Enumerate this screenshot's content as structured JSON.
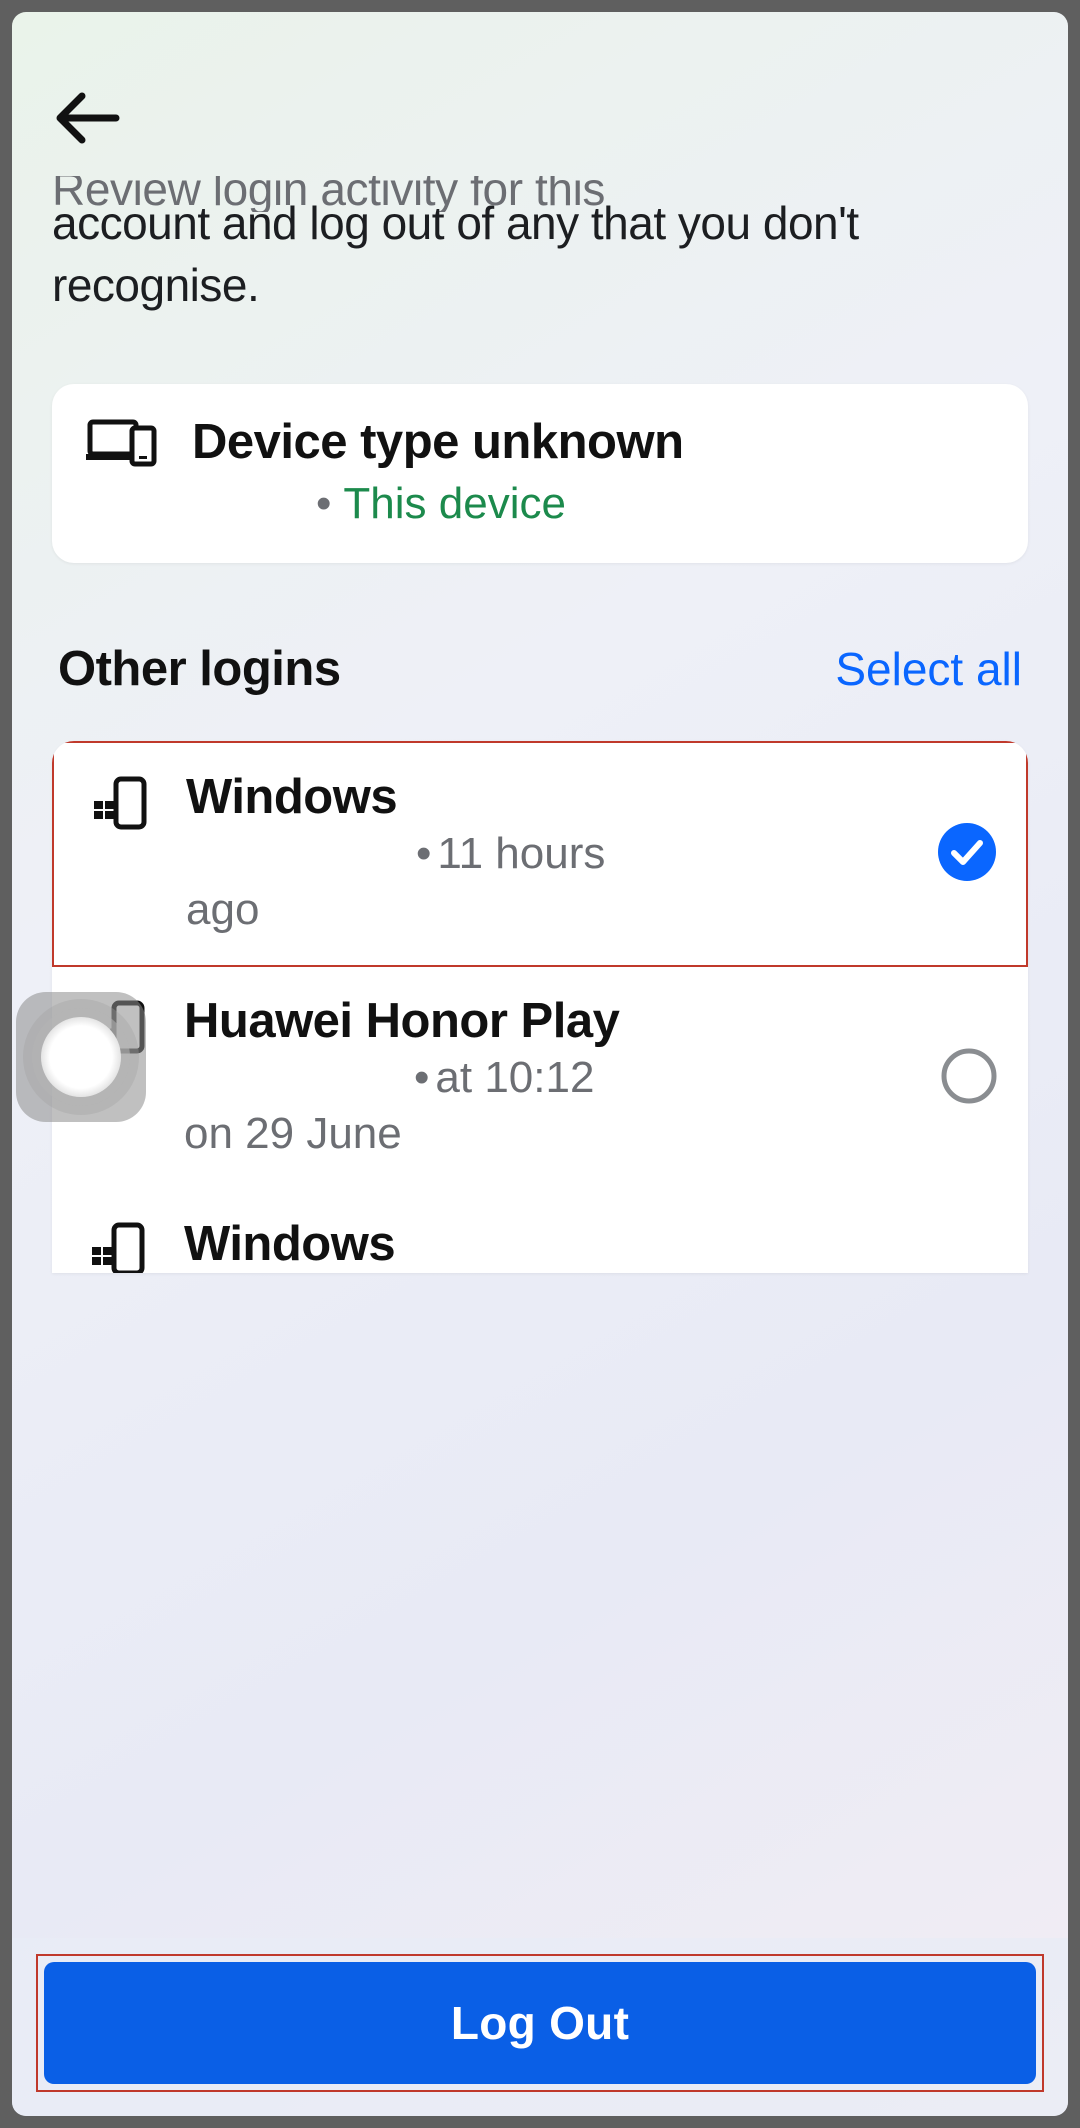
{
  "header": {
    "clipped_text": "Review login activity for this",
    "intro": "account and log out of any that you don't recognise."
  },
  "current_device": {
    "title": "Device type unknown",
    "badge": "This device"
  },
  "other_logins": {
    "title": "Other logins",
    "select_all": "Select all",
    "items": [
      {
        "name": "Windows",
        "meta_inline": "11 hours",
        "meta_line2": "ago",
        "selected": true,
        "highlighted": true,
        "icon": "windows"
      },
      {
        "name": "Huawei Honor Play",
        "meta_inline": "at 10:12",
        "meta_line2": "on 29 June",
        "selected": false,
        "highlighted": false,
        "icon": "android"
      },
      {
        "name": "Windows",
        "meta_inline": "",
        "meta_line2": "",
        "selected": false,
        "highlighted": false,
        "icon": "windows"
      }
    ]
  },
  "footer": {
    "logout": "Log Out"
  }
}
